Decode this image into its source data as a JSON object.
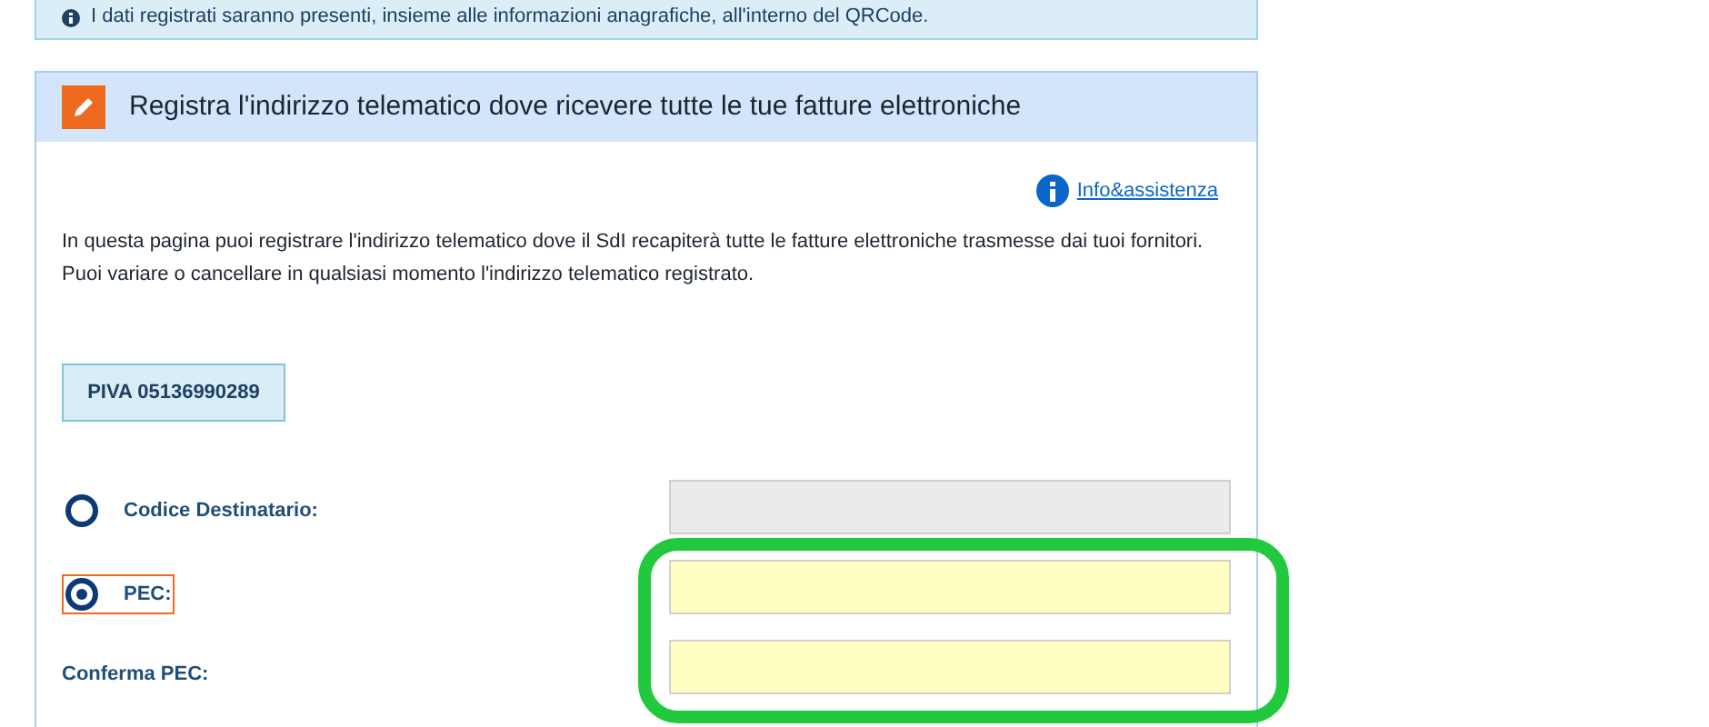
{
  "notice": {
    "text": "I dati registrati saranno presenti, insieme alle informazioni anagrafiche, all'interno del QRCode."
  },
  "card": {
    "title": "Registra l'indirizzo telematico dove ricevere tutte le tue fatture elettroniche",
    "help_link": "Info&assistenza",
    "description": [
      "In questa pagina puoi registrare l'indirizzo telematico dove il SdI recapiterà tutte le fatture elettroniche trasmesse dai tuoi fornitori.",
      "Puoi variare o cancellare in qualsiasi momento l'indirizzo telematico registrato."
    ],
    "piva": "PIVA 05136990289",
    "rows": [
      {
        "kind": "radio",
        "label": "Codice Destinatario:",
        "selected": false,
        "focused": false,
        "disabled": true,
        "highlighted": false
      },
      {
        "kind": "radio",
        "label": "PEC:",
        "selected": true,
        "focused": true,
        "disabled": false,
        "highlighted": true
      },
      {
        "kind": "plain",
        "label": "Conferma PEC:",
        "disabled": false,
        "highlighted": true
      }
    ]
  }
}
